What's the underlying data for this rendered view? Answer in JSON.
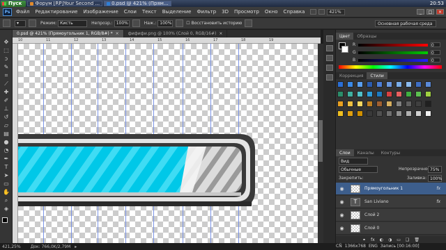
{
  "taskbar": {
    "start": "Пуск",
    "items": [
      {
        "label": "Форум [RP]Your Second ..."
      },
      {
        "label": "0.psd @ 421% (Прям..."
      }
    ],
    "clock": "20:53"
  },
  "menubar": {
    "logo": "Ps",
    "items": [
      "Файл",
      "Редактирование",
      "Изображение",
      "Слои",
      "Текст",
      "Выделение",
      "Фильтр",
      "3D",
      "Просмотр",
      "Окно",
      "Справка"
    ],
    "zoom": "421%"
  },
  "options": {
    "mode_label": "Режим:",
    "mode_value": "Кисть",
    "opacity_label": "Непрозр.:",
    "opacity_value": "100%",
    "pressure_label": "Наж.:",
    "pressure_value": "100%",
    "history_label": "Восстановить историю",
    "workspace": "Основная рабочая среда"
  },
  "tabs": [
    {
      "label": "0.psd @ 421% (Прямоугольник 1, RGB/8#) *",
      "active": true
    },
    {
      "label": "фифифи.png @ 100% (Слой 0, RGB/16#)",
      "active": false
    }
  ],
  "ruler": [
    "10",
    "11",
    "12",
    "13",
    "14",
    "15",
    "16",
    "17",
    "18",
    "19"
  ],
  "status": {
    "zoom": "421,25%",
    "doc": "Док: 766,0K/2,79M"
  },
  "color_panel": {
    "tabs": [
      "Цвет",
      "Образцы"
    ],
    "channels": [
      {
        "label": "R",
        "value": "0"
      },
      {
        "label": "G",
        "value": "0"
      },
      {
        "label": "B",
        "value": "0"
      }
    ]
  },
  "styles_panel": {
    "tabs": [
      "Коррекция",
      "Стили"
    ]
  },
  "layers_panel": {
    "tabs": [
      "Слои",
      "Каналы",
      "Контуры"
    ],
    "kind": "Вид",
    "blend": "Обычные",
    "opacity_label": "Непрозрачность:",
    "opacity_value": "75%",
    "lock_label": "Закрепить:",
    "fill_label": "Заливка:",
    "fill_value": "100%",
    "layers": [
      {
        "name": "Прямоугольник 1",
        "selected": true,
        "fx": true,
        "type": "shape"
      },
      {
        "name": "San Liviano",
        "selected": false,
        "fx": true,
        "type": "text"
      },
      {
        "name": "Слой 2",
        "selected": false,
        "fx": false,
        "type": "pixel"
      },
      {
        "name": "Слой 0",
        "selected": false,
        "fx": false,
        "type": "pixel"
      }
    ]
  },
  "bottom_taskbar": {
    "items": [
      "CÑ",
      "1366x768",
      "ENG"
    ],
    "record": "Запись [00:16:00]",
    "fx_label": "fx"
  },
  "colors": {
    "bar_fill": "#00c4e4",
    "bar_frame": "#3a3a3a",
    "guide": "#6f8be6",
    "selected_layer": "#3d5e8c"
  }
}
